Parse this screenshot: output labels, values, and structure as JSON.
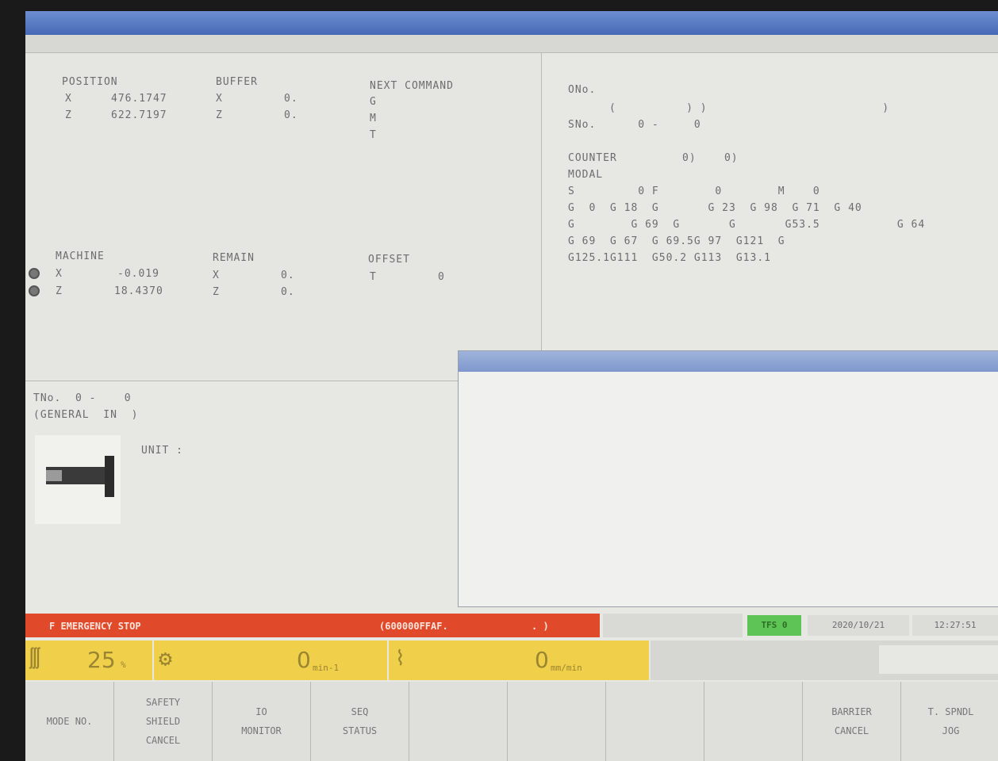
{
  "window": {
    "title": "",
    "menu": []
  },
  "position": {
    "heading": "POSITION",
    "x_label": "X",
    "x_value": "476.1747",
    "z_label": "Z",
    "z_value": "622.7197"
  },
  "buffer": {
    "heading": "BUFFER",
    "x_label": "X",
    "x_value": "0.",
    "z_label": "Z",
    "z_value": "0."
  },
  "next_command": {
    "heading": "NEXT COMMAND",
    "g": "G",
    "m": "M",
    "t": "T"
  },
  "machine": {
    "heading": "MACHINE",
    "x_label": "X",
    "x_value": "-0.019",
    "z_label": "Z",
    "z_value": "18.4370"
  },
  "remain": {
    "heading": "REMAIN",
    "x_label": "X",
    "x_value": "0.",
    "z_label": "Z",
    "z_value": "0."
  },
  "offset": {
    "heading": "OFFSET",
    "t_label": "T",
    "t_value": "0"
  },
  "right_panel": {
    "line1": "ONo.",
    "line2": "(          ) )                         )",
    "line3": "SNo.      0 -     0",
    "counter_label": "COUNTER",
    "counter_value": "0)    0)",
    "modal_label": "MODAL",
    "modal_rows": [
      "S         0 F        0        M    0",
      "G  0  G 18  G       G 23  G 98  G 71  G 40",
      "G        G 69  G       G       G53.5           G 64",
      "G 69  G 67  G 69.5G 97  G121  G",
      "G125.1G111  G50.2 G113  G13.1"
    ]
  },
  "tool": {
    "tno": "TNo.  0 -    0",
    "general": "(GENERAL  IN  )",
    "unit": "UNIT :"
  },
  "message_window": {
    "title": ""
  },
  "alarm": {
    "text": "F EMERGENCY STOP",
    "code": "(600000FFAF.",
    "tail": ".           )"
  },
  "status": {
    "tfs": "TFS 0",
    "date": "2020/10/21",
    "time": "12:27:51"
  },
  "overrides": {
    "rapid_value": "25",
    "rapid_unit": "%",
    "spindle_value": "0",
    "spindle_unit": "min-1",
    "feed_value": "0",
    "feed_unit": "mm/min"
  },
  "softkeys": [
    {
      "lines": [
        "MODE NO."
      ]
    },
    {
      "lines": [
        "SAFETY",
        "SHIELD",
        "CANCEL"
      ]
    },
    {
      "lines": [
        "IO",
        "MONITOR"
      ]
    },
    {
      "lines": [
        "SEQ",
        "STATUS"
      ]
    },
    {
      "lines": []
    },
    {
      "lines": []
    },
    {
      "lines": []
    },
    {
      "lines": []
    },
    {
      "lines": [
        "BARRIER",
        "CANCEL"
      ]
    },
    {
      "lines": [
        "T. SPNDL",
        "JOG"
      ]
    }
  ]
}
